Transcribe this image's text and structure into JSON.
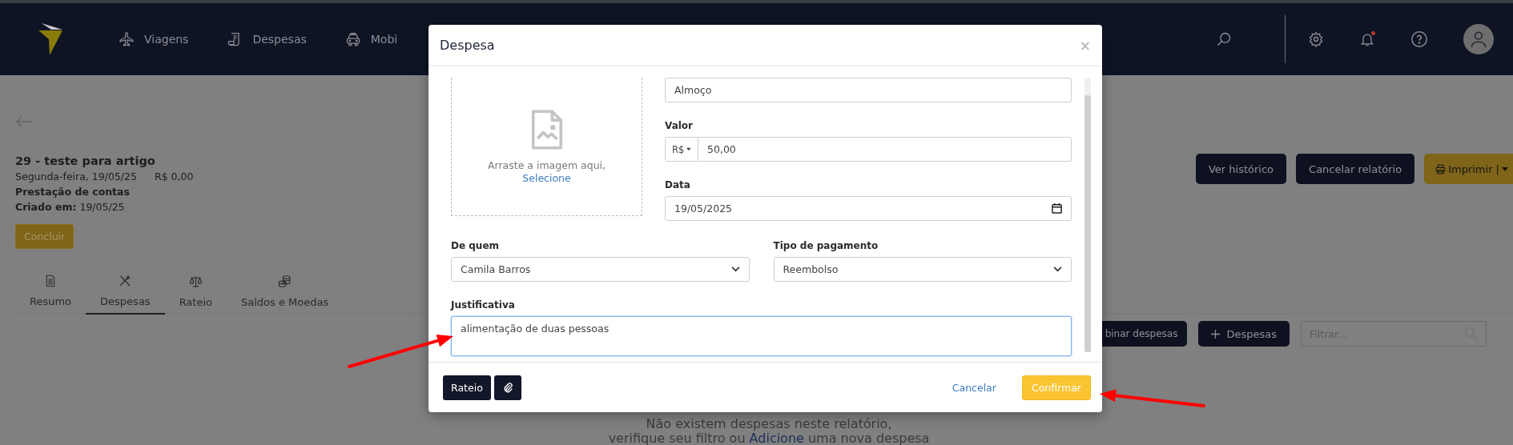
{
  "header": {
    "nav": [
      {
        "label": "Viagens",
        "kind": "plane"
      },
      {
        "label": "Despesas",
        "kind": "receipt"
      },
      {
        "label": "Mobi",
        "kind": "car"
      }
    ],
    "notification_unread": true
  },
  "report": {
    "title": "29 - teste para artigo",
    "date": "Segunda-feira, 19/05/25",
    "amount": "R$ 0,00",
    "type": "Prestação de contas",
    "created": "**Criado em:** 19/05/25",
    "conclude_button": "Concluir"
  },
  "tabs": [
    {
      "label": "Resumo",
      "kind": "document",
      "selected": false
    },
    {
      "label": "Despesas",
      "kind": "utensils",
      "selected": true
    },
    {
      "label": "Rateio",
      "kind": "scale",
      "selected": false
    },
    {
      "label": "Saldos e Moedas",
      "kind": "coins",
      "selected": false
    }
  ],
  "actions": [
    "Ver histórico",
    "Cancelar relatório"
  ],
  "print_button": "Imprimir |",
  "toolbar": {
    "combine_button": "binar despesas",
    "add_button": "Despesas",
    "filter": {
      "placeholder": "Filtrar..."
    }
  },
  "empty_state": {
    "line_1": "Não existem despesas neste relatório,",
    "line_2_before": "verifique seu filtro ou ",
    "link": "Adicione",
    "line_2_after": " uma nova despesa"
  },
  "modal": {
    "title": "Despesa",
    "close": "×",
    "upload": {
      "prompt": "Arraste a imagem aqui,",
      "link": "Selecione"
    },
    "description": {
      "value": "Almoço"
    },
    "amount": {
      "label": "Valor",
      "currency": "R$",
      "value": "50,00"
    },
    "date": {
      "label": "Data",
      "value": "19/05/2025"
    },
    "from": {
      "label": "De quem",
      "value": "Camila Barros"
    },
    "payment": {
      "label": "Tipo de pagamento",
      "value": "Reembolso"
    },
    "justification": {
      "label": "Justificativa",
      "value": "alimentação de duas pessoas",
      "focused": true
    },
    "footer": {
      "split_button": "Rateio",
      "cancel_link": "Cancelar",
      "confirm_button": "Confirmar"
    }
  },
  "annotations": [
    {
      "kind": "arrow"
    },
    {
      "kind": "arrow"
    }
  ]
}
